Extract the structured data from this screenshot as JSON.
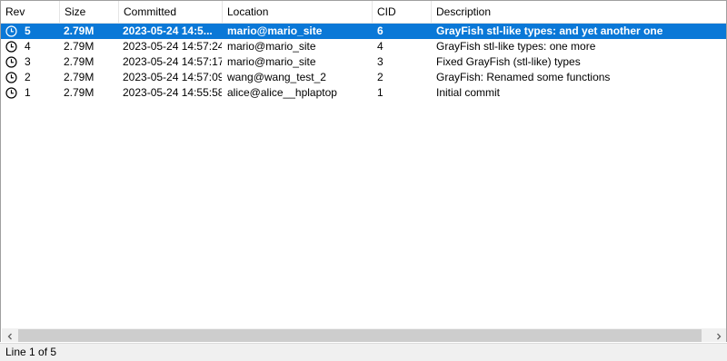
{
  "columns": [
    "Rev",
    "Size",
    "Committed",
    "Location",
    "CID",
    "Description"
  ],
  "rows": [
    {
      "rev": "5",
      "size": "2.79M",
      "committed": "2023-05-24 14:5...",
      "location": "mario@mario_site",
      "cid": "6",
      "description": "GrayFish stl-like types: and yet another one",
      "selected": true
    },
    {
      "rev": "4",
      "size": "2.79M",
      "committed": "2023-05-24 14:57:24",
      "location": "mario@mario_site",
      "cid": "4",
      "description": "GrayFish stl-like types: one more",
      "selected": false
    },
    {
      "rev": "3",
      "size": "2.79M",
      "committed": "2023-05-24 14:57:17",
      "location": "mario@mario_site",
      "cid": "3",
      "description": "Fixed GrayFish (stl-like) types",
      "selected": false
    },
    {
      "rev": "2",
      "size": "2.79M",
      "committed": "2023-05-24 14:57:09",
      "location": "wang@wang_test_2",
      "cid": "2",
      "description": "GrayFish: Renamed some functions",
      "selected": false
    },
    {
      "rev": "1",
      "size": "2.79M",
      "committed": "2023-05-24 14:55:58",
      "location": "alice@alice__hplaptop",
      "cid": "1",
      "description": "Initial commit",
      "selected": false
    }
  ],
  "status": {
    "text": "Line 1 of 5"
  },
  "colors": {
    "selection": "#0a78d7",
    "chrome": "#f0f0f0",
    "scroll_thumb": "#cdcdcd"
  },
  "icons": {
    "row_icon": "clock-icon",
    "scroll_left": "chevron-left-icon",
    "scroll_right": "chevron-right-icon"
  }
}
